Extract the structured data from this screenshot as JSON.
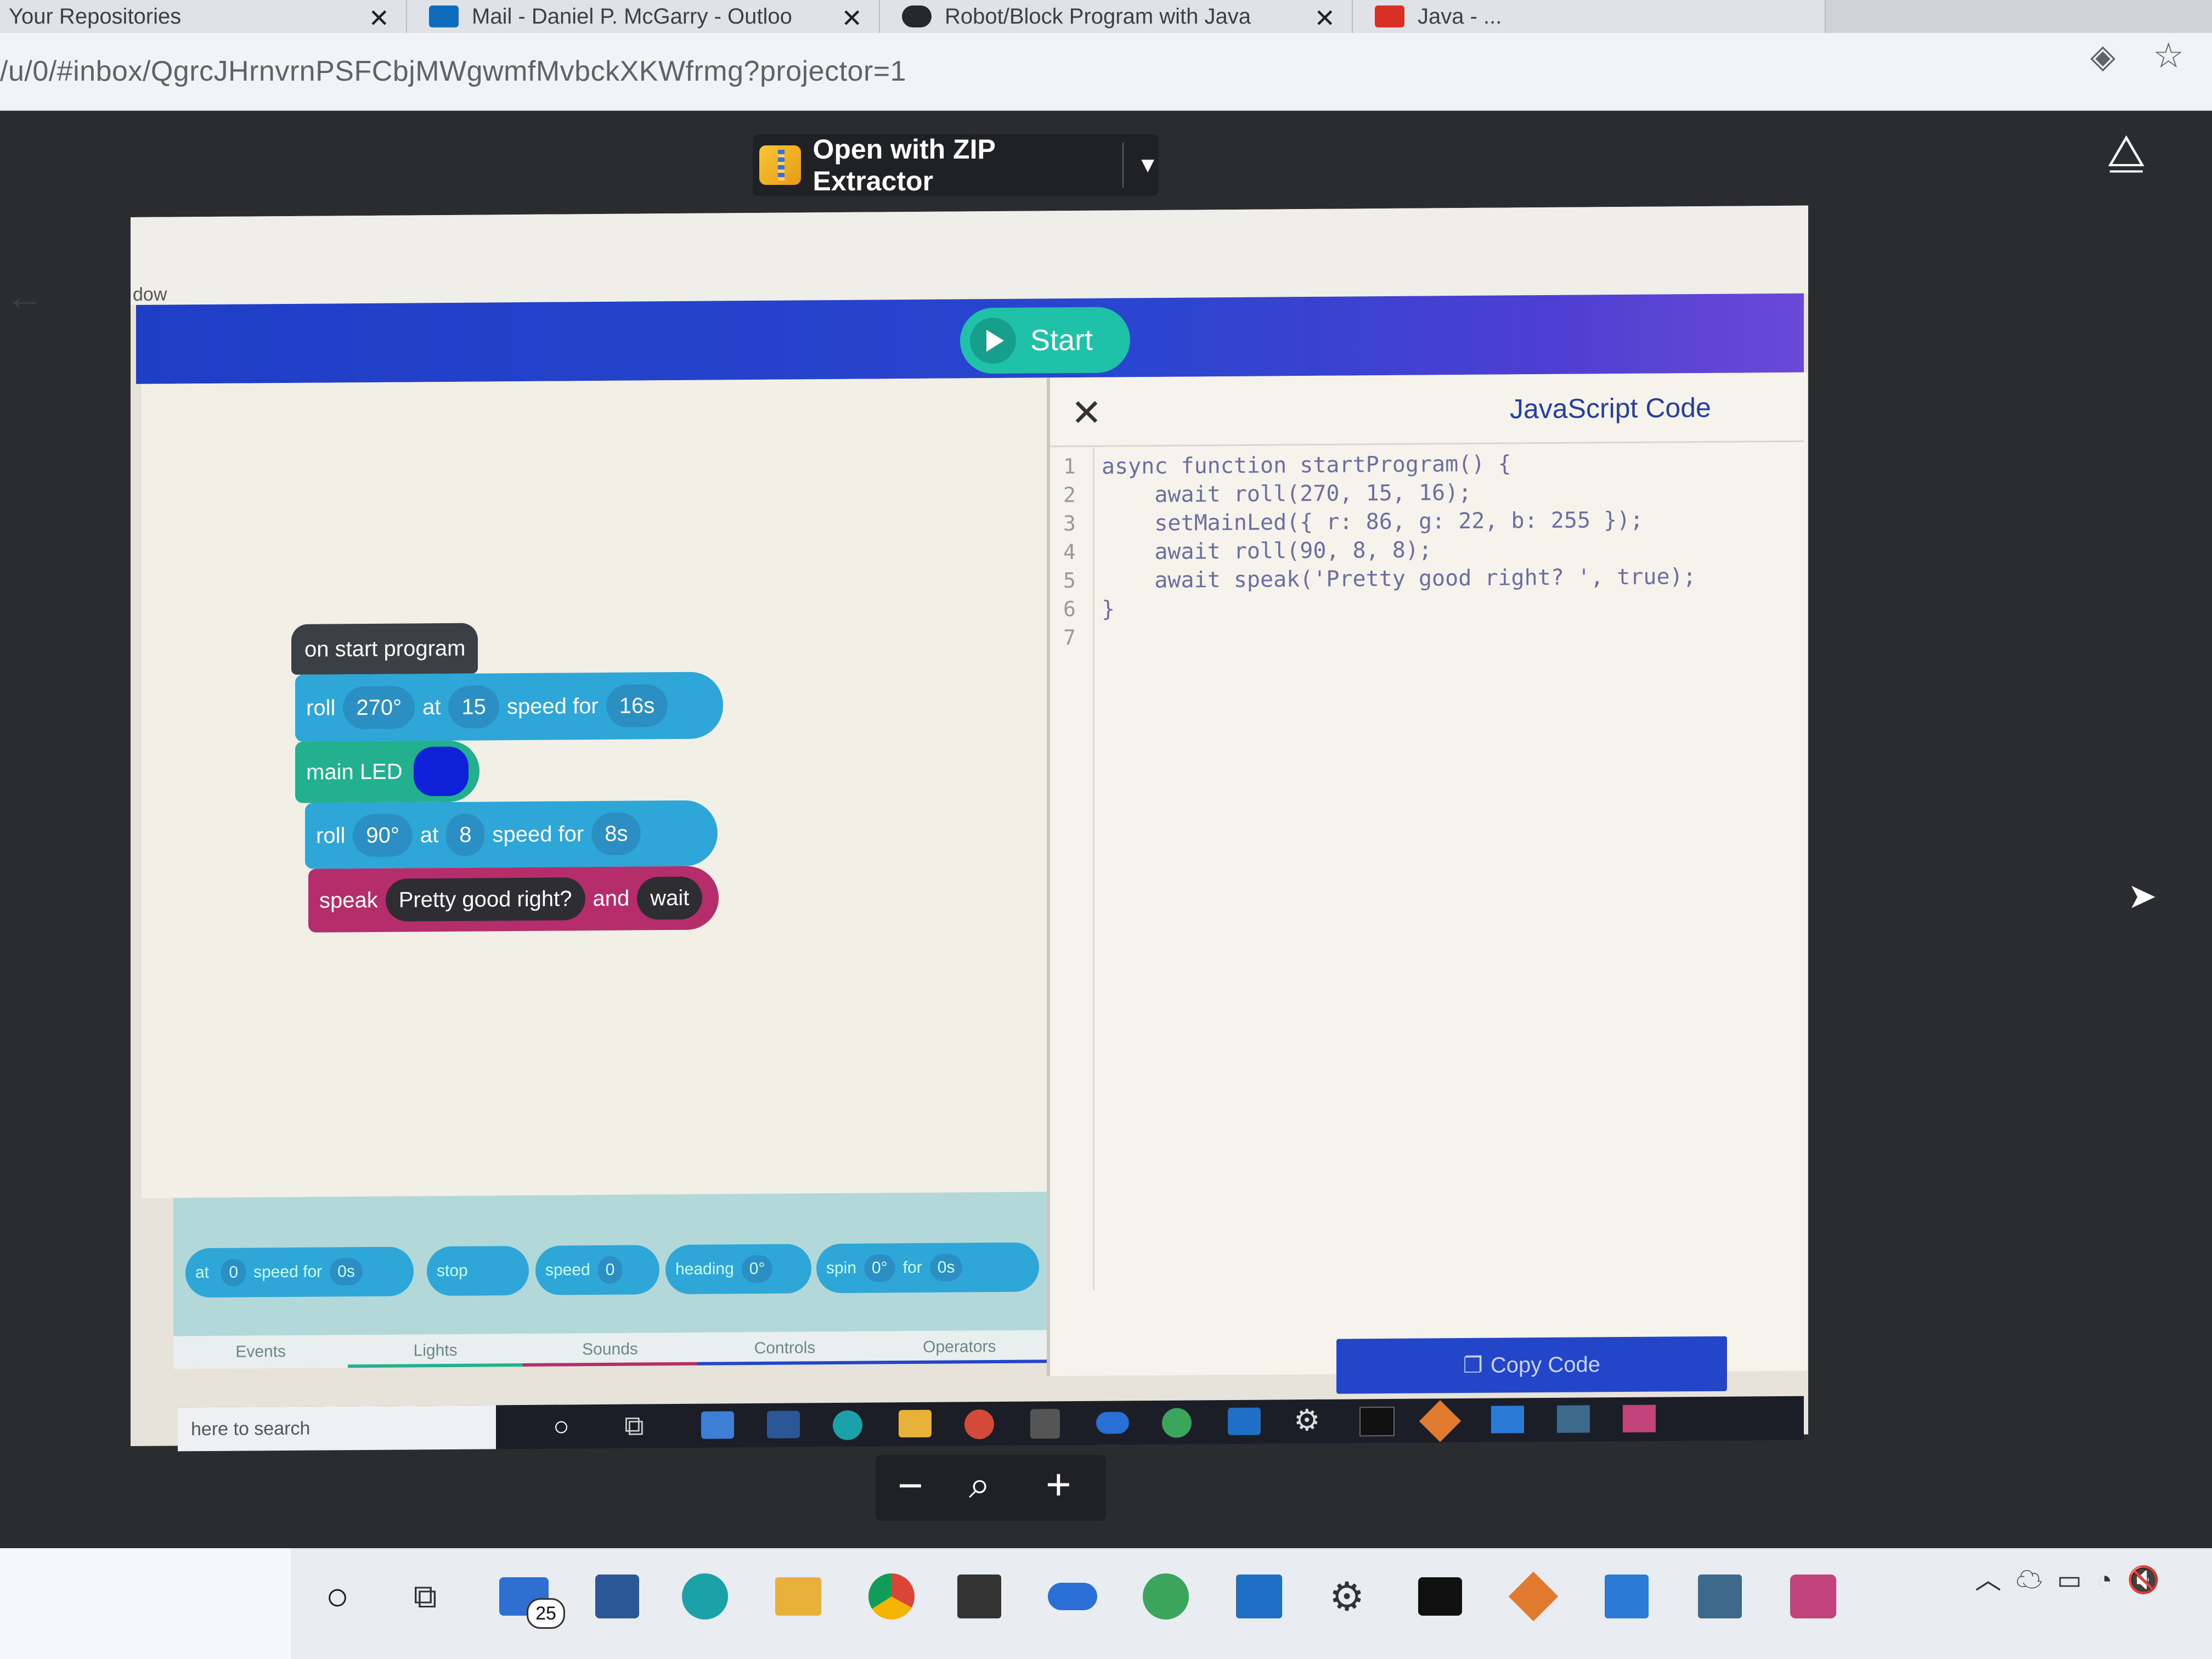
{
  "browser": {
    "tabs": [
      {
        "title": "Your Repositories"
      },
      {
        "title": "Mail - Daniel P. McGarry - Outloo"
      },
      {
        "title": "Robot/Block Program with Java"
      },
      {
        "title": "Java - ..."
      }
    ],
    "url": "/u/0/#inbox/QgrcJHrnvrnPSFCbjMWgwmfMvbckXKWfrmg?projector=1"
  },
  "viewer": {
    "open_with_label": "Open with ZIP Extractor",
    "zoom_minus": "−",
    "zoom_plus": "+"
  },
  "app": {
    "window_title": "dow",
    "start_label": "Start",
    "blocks": {
      "start": "on start program",
      "roll1": {
        "label": "roll",
        "heading": "270°",
        "at": "at",
        "speed": "15",
        "speed_for": "speed for",
        "dur": "16s"
      },
      "led": {
        "label": "main LED",
        "color": "#0f21d8"
      },
      "roll2": {
        "label": "roll",
        "heading": "90°",
        "at": "at",
        "speed": "8",
        "speed_for": "speed for",
        "dur": "8s"
      },
      "speak": {
        "label": "speak",
        "text": "Pretty good right?",
        "and": "and",
        "wait": "wait"
      }
    },
    "palette": {
      "blocks": [
        "at",
        "0",
        "speed for",
        "0s",
        "stop",
        "speed",
        "0",
        "heading",
        "0°",
        "spin",
        "0°",
        "for",
        "0s"
      ],
      "tabs": [
        "Events",
        "Lights",
        "Sounds",
        "Controls",
        "Operators"
      ]
    },
    "code": {
      "title": "JavaScript Code",
      "copy_label": "Copy Code",
      "lines": [
        "async function startProgram() {",
        "    await roll(270, 15, 16);",
        "    setMainLed({ r: 86, g: 22, b: 255 });",
        "    await roll(90, 8, 8);",
        "    await speak('Pretty good right? ', true);",
        "}",
        ""
      ],
      "line_numbers": [
        "1",
        "2",
        "3",
        "4",
        "5",
        "6",
        "7"
      ]
    },
    "inner_taskbar_search": "here to search"
  },
  "taskbar": {
    "mail_badge": "25"
  }
}
